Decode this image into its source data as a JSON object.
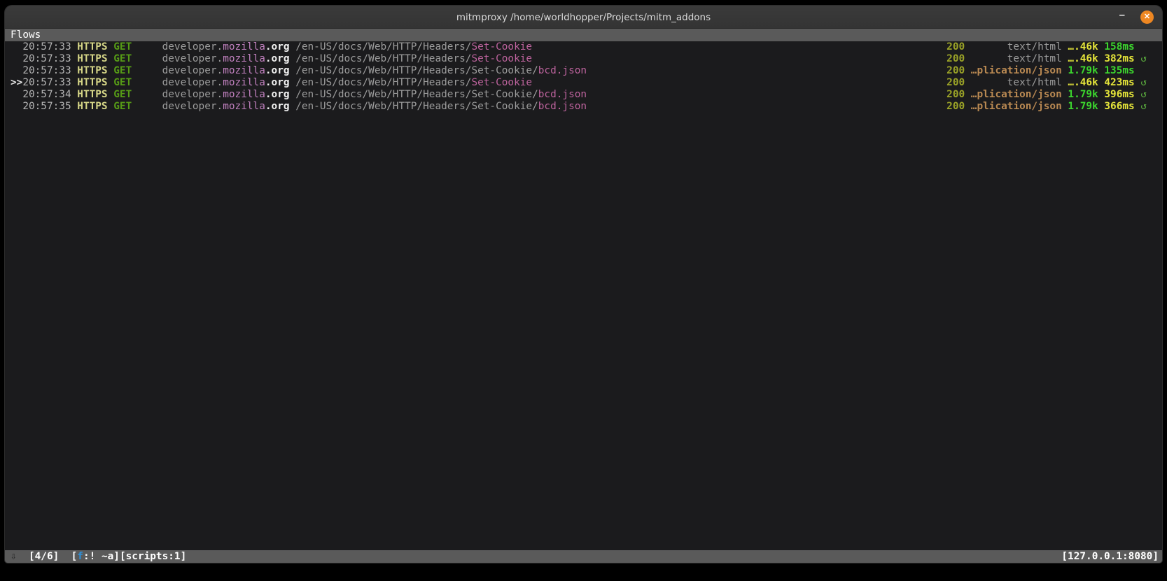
{
  "window": {
    "title": "mitmproxy /home/worldhopper/Projects/mitm_addons",
    "minimize_glyph": "–",
    "close_glyph": "✕"
  },
  "flows_header": {
    "label": "Flows"
  },
  "flows": [
    {
      "marker": "",
      "timestamp": "20:57:33",
      "scheme": "HTTPS",
      "method": "GET",
      "host_dim": "developer.",
      "host_accent": "mozilla",
      "host_bold": ".org",
      "path_dim": "/en-US/docs/Web/HTTP/Headers/",
      "path_accent": "Set-Cookie",
      "status": "200",
      "content_type": "text/html",
      "content_type_style": "html",
      "size": "….46k",
      "size_style": "yellow",
      "duration": "158ms",
      "duration_style": "green",
      "replay": ""
    },
    {
      "marker": "",
      "timestamp": "20:57:33",
      "scheme": "HTTPS",
      "method": "GET",
      "host_dim": "developer.",
      "host_accent": "mozilla",
      "host_bold": ".org",
      "path_dim": "/en-US/docs/Web/HTTP/Headers/",
      "path_accent": "Set-Cookie",
      "status": "200",
      "content_type": "text/html",
      "content_type_style": "html",
      "size": "….46k",
      "size_style": "yellow",
      "duration": "382ms",
      "duration_style": "yellow",
      "replay": "↺"
    },
    {
      "marker": "",
      "timestamp": "20:57:33",
      "scheme": "HTTPS",
      "method": "GET",
      "host_dim": "developer.",
      "host_accent": "mozilla",
      "host_bold": ".org",
      "path_dim": "/en-US/docs/Web/HTTP/Headers/Set-Cookie/",
      "path_accent": "bcd.json",
      "status": "200",
      "content_type": "…plication/json",
      "content_type_style": "json",
      "size": "1.79k",
      "size_style": "green",
      "duration": "135ms",
      "duration_style": "green",
      "replay": ""
    },
    {
      "marker": ">>",
      "timestamp": "20:57:33",
      "scheme": "HTTPS",
      "method": "GET",
      "host_dim": "developer.",
      "host_accent": "mozilla",
      "host_bold": ".org",
      "path_dim": "/en-US/docs/Web/HTTP/Headers/",
      "path_accent": "Set-Cookie",
      "status": "200",
      "content_type": "text/html",
      "content_type_style": "html",
      "size": "….46k",
      "size_style": "yellow",
      "duration": "423ms",
      "duration_style": "yellow",
      "replay": "↺"
    },
    {
      "marker": "",
      "timestamp": "20:57:34",
      "scheme": "HTTPS",
      "method": "GET",
      "host_dim": "developer.",
      "host_accent": "mozilla",
      "host_bold": ".org",
      "path_dim": "/en-US/docs/Web/HTTP/Headers/Set-Cookie/",
      "path_accent": "bcd.json",
      "status": "200",
      "content_type": "…plication/json",
      "content_type_style": "json",
      "size": "1.79k",
      "size_style": "green",
      "duration": "396ms",
      "duration_style": "yellow",
      "replay": "↺"
    },
    {
      "marker": "",
      "timestamp": "20:57:35",
      "scheme": "HTTPS",
      "method": "GET",
      "host_dim": "developer.",
      "host_accent": "mozilla",
      "host_bold": ".org",
      "path_dim": "/en-US/docs/Web/HTTP/Headers/Set-Cookie/",
      "path_accent": "bcd.json",
      "status": "200",
      "content_type": "…plication/json",
      "content_type_style": "json",
      "size": "1.79k",
      "size_style": "green",
      "duration": "366ms",
      "duration_style": "yellow",
      "replay": "↺"
    }
  ],
  "statusbar": {
    "icon": "⇩",
    "flow_count": "[4/6]",
    "filter_open": "[",
    "filter_key": "f",
    "filter_rest": ":! ~a]",
    "scripts": "[scripts:1]",
    "address": "[127.0.0.1:8080]"
  },
  "colors": {
    "terminal_bg": "#1b1b1d",
    "titlebar_bg": "#3a3a3a",
    "bar_bg": "#5a5a5a",
    "close_btn": "#ee8722",
    "text_bright": "#f2f2f2",
    "text_gray": "#b5b5b5",
    "text_dim": "#9c9c9c",
    "scheme_khaki": "#d6d687",
    "method_green": "#569b16",
    "host_pink": "#c080be",
    "path_pink": "#bd639d",
    "status_olive": "#9aa227",
    "tan_json": "#b98952",
    "yellow": "#e5e53a",
    "bright_green": "#3cd62e",
    "replay_green": "#58a73c",
    "filter_blue": "#2d8fd8"
  }
}
